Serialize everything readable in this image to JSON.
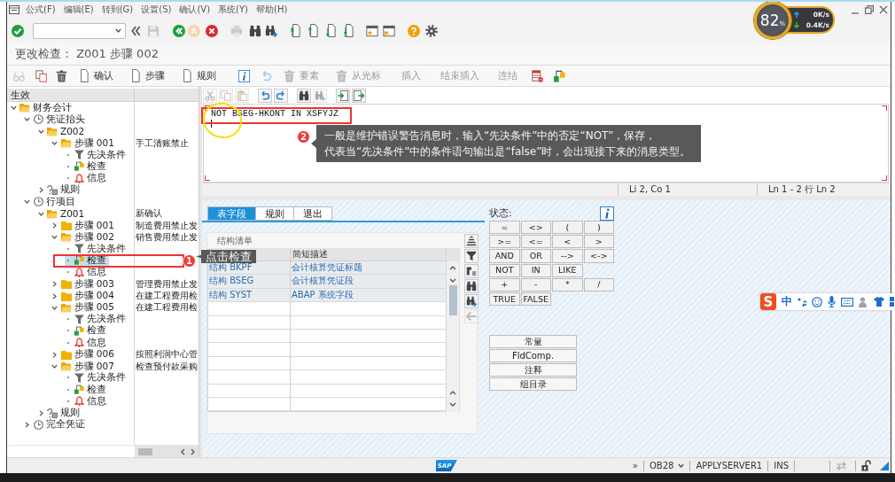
{
  "menu_bar": {
    "items": [
      "公式(F)",
      "编辑(E)",
      "转到(G)",
      "设置(S)",
      "确认(V)",
      "系统(Y)",
      "帮助(H)"
    ]
  },
  "speed_widget": {
    "percent": "82",
    "unit": "%",
    "upload": "0K/s",
    "download": "0.4K/s"
  },
  "toolbar": [
    {
      "kind": "enter",
      "disabled": false
    },
    {
      "kind": "command_field"
    },
    {
      "kind": "collapse",
      "disabled": false
    },
    {
      "kind": "save",
      "disabled": true
    },
    {
      "kind": "back",
      "disabled": false
    },
    {
      "kind": "exit",
      "disabled": true
    },
    {
      "kind": "cancel",
      "disabled": false
    },
    {
      "kind": "print",
      "disabled": true
    },
    {
      "kind": "find",
      "disabled": false
    },
    {
      "kind": "find_next",
      "disabled": false
    },
    {
      "kind": "first_page",
      "disabled": false
    },
    {
      "kind": "previous_page",
      "disabled": false
    },
    {
      "kind": "next_page",
      "disabled": false
    },
    {
      "kind": "last_page",
      "disabled": false
    },
    {
      "kind": "new_session",
      "disabled": false
    },
    {
      "kind": "shortcut",
      "disabled": false
    },
    {
      "kind": "help",
      "disabled": false
    },
    {
      "kind": "settings",
      "disabled": false
    }
  ],
  "title": "更改检查： Z001 步骤 002",
  "app_toolbar": [
    {
      "kind": "display",
      "disabled": true
    },
    {
      "kind": "copy",
      "disabled": false
    },
    {
      "kind": "delete",
      "disabled": false
    },
    {
      "kind": "create",
      "label": "确认",
      "disabled": false
    },
    {
      "kind": "create",
      "label": "步骤",
      "disabled": false
    },
    {
      "kind": "create",
      "label": "规则",
      "disabled": false
    },
    {
      "kind": "info",
      "disabled": false
    },
    {
      "kind": "undo",
      "disabled": true
    },
    {
      "kind": "delete",
      "label": "要素",
      "disabled": true
    },
    {
      "kind": "delete",
      "label": "从光标",
      "disabled": true
    },
    {
      "kind": "text",
      "label": "插入",
      "disabled": true
    },
    {
      "kind": "text",
      "label": "结束插入",
      "disabled": true
    },
    {
      "kind": "text",
      "label": "连结",
      "disabled": true
    },
    {
      "kind": "table",
      "disabled": false
    },
    {
      "kind": "hierarchy",
      "disabled": false
    }
  ],
  "tree": {
    "header": "生效",
    "items": [
      {
        "kind": "folder",
        "label": "财务会计",
        "expanded": true,
        "selected": false,
        "children": [
          {
            "kind": "group",
            "label": "凭证抬头",
            "expanded": true,
            "selected": false,
            "children": [
              {
                "kind": "folder",
                "label": "Z002",
                "expanded": true,
                "selected": false,
                "children": [
                  {
                    "kind": "folder",
                    "label": "步骤 001",
                    "description": "手工清账禁止",
                    "expanded": true,
                    "selected": false,
                    "children": [
                      {
                        "kind": "condition",
                        "label": "先决条件",
                        "selected": false
                      },
                      {
                        "kind": "check",
                        "label": "检查",
                        "selected": false
                      },
                      {
                        "kind": "message",
                        "label": "信息",
                        "selected": false
                      }
                    ]
                  }
                ]
              },
              {
                "kind": "rule",
                "label": "规则",
                "expanded": false,
                "selected": false
              }
            ]
          },
          {
            "kind": "group",
            "label": "行项目",
            "expanded": true,
            "selected": false,
            "children": [
              {
                "kind": "folder",
                "label": "Z001",
                "description": "新确认",
                "expanded": true,
                "selected": false,
                "children": [
                  {
                    "kind": "folder",
                    "label": "步骤 001",
                    "description": "制造费用禁止发",
                    "expanded": false,
                    "selected": false
                  },
                  {
                    "kind": "folder",
                    "label": "步骤 002",
                    "description": "销售费用禁止发",
                    "expanded": true,
                    "selected": false,
                    "children": [
                      {
                        "kind": "condition",
                        "label": "先决条件",
                        "selected": false
                      },
                      {
                        "kind": "check",
                        "label": "检查",
                        "selected": true
                      },
                      {
                        "kind": "message",
                        "label": "信息",
                        "selected": false
                      }
                    ]
                  },
                  {
                    "kind": "folder",
                    "label": "步骤 003",
                    "description": "管理费用禁止发",
                    "expanded": false,
                    "selected": false
                  },
                  {
                    "kind": "folder",
                    "label": "步骤 004",
                    "description": "在建工程费用检",
                    "expanded": false,
                    "selected": false
                  },
                  {
                    "kind": "folder",
                    "label": "步骤 005",
                    "description": "在建工程费用检",
                    "expanded": true,
                    "selected": false,
                    "children": [
                      {
                        "kind": "condition",
                        "label": "先决条件",
                        "selected": false
                      },
                      {
                        "kind": "check",
                        "label": "检查",
                        "selected": false
                      },
                      {
                        "kind": "message",
                        "label": "信息",
                        "selected": false
                      }
                    ]
                  },
                  {
                    "kind": "folder",
                    "label": "步骤 006",
                    "description": "按照利润中心管",
                    "expanded": false,
                    "selected": false
                  },
                  {
                    "kind": "folder",
                    "label": "步骤 007",
                    "description": "检查预付款采购",
                    "expanded": true,
                    "selected": false,
                    "children": [
                      {
                        "kind": "condition",
                        "label": "先决条件",
                        "selected": false
                      },
                      {
                        "kind": "check",
                        "label": "检查",
                        "selected": false
                      },
                      {
                        "kind": "message",
                        "label": "信息",
                        "selected": false
                      }
                    ]
                  }
                ]
              },
              {
                "kind": "rule",
                "label": "规则",
                "expanded": false,
                "selected": false
              }
            ]
          },
          {
            "kind": "group",
            "label": "完全凭证",
            "expanded": false,
            "selected": false
          }
        ]
      }
    ]
  },
  "editor_toolbar": [
    {
      "kind": "cut",
      "disabled": true
    },
    {
      "kind": "copy",
      "disabled": true
    },
    {
      "kind": "paste",
      "disabled": true
    },
    {
      "kind": "undo",
      "disabled": false
    },
    {
      "kind": "redo",
      "disabled": false
    },
    {
      "kind": "find",
      "disabled": false
    },
    {
      "kind": "find_next",
      "disabled": true
    },
    {
      "kind": "import",
      "disabled": false
    },
    {
      "kind": "export",
      "disabled": false
    }
  ],
  "editor": {
    "lines": [
      "NOT BSEG-HKONT IN XSFYJZ"
    ],
    "cursor": "Li 2, Co 1",
    "range": "Ln 1 - 2 行 Ln 2"
  },
  "tabs": [
    {
      "label": "表字段",
      "selected": true
    },
    {
      "label": "规则",
      "selected": false
    },
    {
      "label": "退出",
      "selected": false
    }
  ],
  "structure_list": {
    "title": "结构清单",
    "column_2": "简短描述",
    "rows": [
      [
        "结构 BKPF",
        "会计核算凭证标题"
      ],
      [
        "结构 BSEG",
        "会计核算凭证段"
      ],
      [
        "结构 SYST",
        "ABAP 系统字段"
      ]
    ]
  },
  "list_toolbar": [
    {
      "kind": "sort",
      "disabled": false
    },
    {
      "kind": "filter",
      "disabled": false
    },
    {
      "kind": "where_used",
      "disabled": false
    },
    {
      "kind": "find",
      "disabled": false
    },
    {
      "kind": "find_next",
      "disabled": false
    },
    {
      "kind": "back",
      "disabled": true
    }
  ],
  "operators": {
    "label": "状态:",
    "rows": [
      [
        "=",
        "<>",
        "(",
        ")"
      ],
      [
        ">=",
        "<=",
        "<",
        ">"
      ],
      [
        "AND",
        "OR",
        "-->",
        "<->"
      ],
      [
        "NOT",
        "IN",
        "LIKE"
      ],
      [
        "+",
        "-",
        "*",
        "/"
      ],
      [
        "TRUE",
        "FALSE"
      ]
    ]
  },
  "actions": [
    "常量",
    "FldComp.",
    "注释",
    "组目录"
  ],
  "ime_bar": {
    "logo": "S",
    "mode": "中"
  },
  "status_bar": {
    "logo": "SAP",
    "expand": "»",
    "transaction": "OB28",
    "server": "APPLYSERVER1",
    "mode": "INS"
  },
  "annotations": [
    {
      "number": "1",
      "lines": [
        "点击检查"
      ]
    },
    {
      "number": "2",
      "lines": [
        "一般是维护错误警告消息时，输入“先决条件”中的否定“NOT”，保存，",
        "代表当“先决条件”中的条件语句输出是“false”时，会出现接下来的消息类型。"
      ]
    }
  ]
}
